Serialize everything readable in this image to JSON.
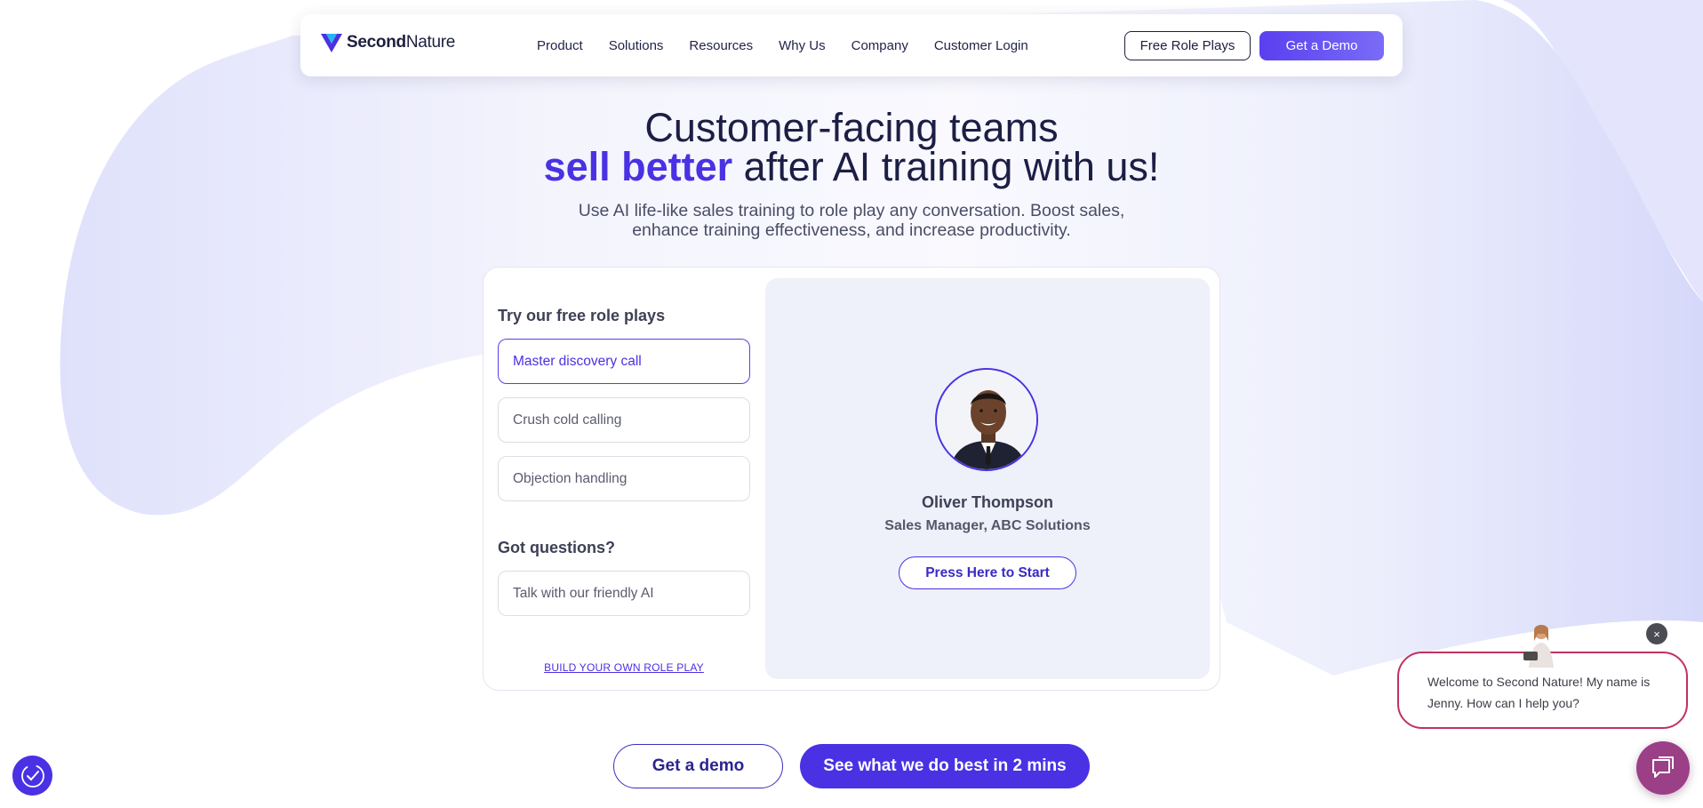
{
  "brand": {
    "name_bold": "Second",
    "name_light": "Nature",
    "accent": "#4a31e3"
  },
  "nav": {
    "links": [
      "Product",
      "Solutions",
      "Resources",
      "Why Us",
      "Company",
      "Customer Login"
    ],
    "free_role_plays": "Free Role Plays",
    "get_demo": "Get a Demo"
  },
  "hero": {
    "title_line1": "Customer-facing teams",
    "title_accent": "sell better",
    "title_rest": " after AI training with us!",
    "subtitle_line1": "Use AI life-like sales training to role play any conversation. Boost sales,",
    "subtitle_line2": "enhance training effectiveness, and increase productivity."
  },
  "roleplay": {
    "heading": "Try our free role plays",
    "options": [
      "Master discovery call",
      "Crush cold calling",
      "Objection handling"
    ],
    "questions_heading": "Got questions?",
    "talk_option": "Talk with our friendly AI",
    "build_link": "BUILD YOUR OWN ROLE PLAY",
    "persona": {
      "name": "Oliver Thompson",
      "role": "Sales Manager, ABC Solutions",
      "start_label": "Press Here to Start"
    }
  },
  "cta": {
    "demo": "Get a demo",
    "watch": "See what we do best in 2 mins"
  },
  "chat": {
    "message": "Welcome to Second Nature! My name is Jenny. How can I help you?",
    "close_glyph": "×"
  },
  "icons": {
    "logo": "v-shield-logo-icon",
    "accessibility": "accessibility-icon",
    "chat": "chat-bubble-icon"
  }
}
